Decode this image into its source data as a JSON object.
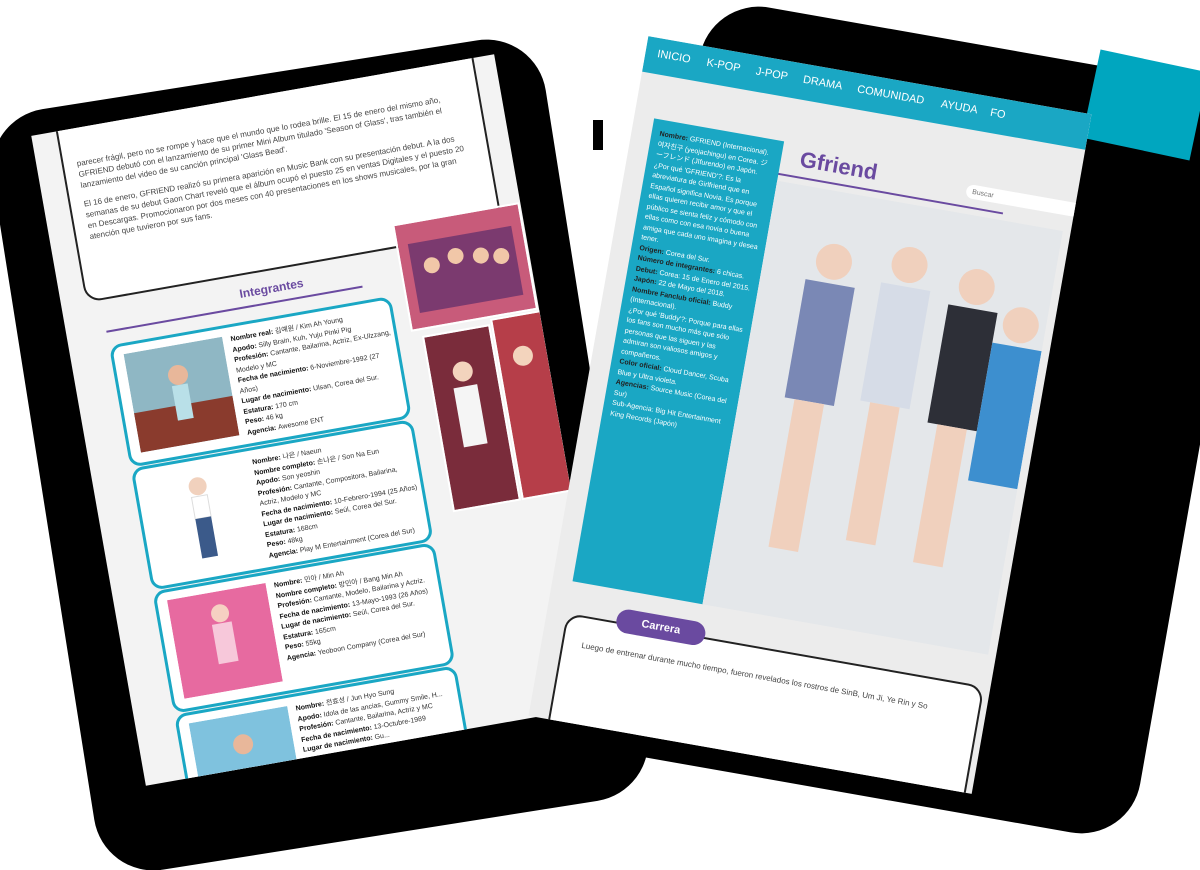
{
  "colors": {
    "teal": "#1aa7c4",
    "purple": "#6a4aa0",
    "page_bg": "#ececec"
  },
  "back_page": {
    "paragraph_1": "parecer frágil, pero no se rompe y hace que el mundo que lo rodea brille. El 15 de enero del mismo año, GFRIEND debutó con el lanzamiento de su primer Mini Album titulado 'Season of Glass', tras también el lanzamiento del video de su canción principal 'Glass Bead'.",
    "paragraph_2": "El 16 de enero, GFRIEND realizó su primera aparición en Music Bank con su presentación debut. A la dos semanas de su debut Gaon Chart reveló que el álbum ocupó el puesto 25 en ventas Digitales y el puesto 20 en Descargas. Promocionaron por dos meses con 40 presentaciones en los shows musicales, por la gran atención que tuvieron por sus fans.",
    "heading": "Integrantes",
    "members": [
      {
        "lines": [
          {
            "label": "Nombre real:",
            "value": "김예원 / Kim Ah Young"
          },
          {
            "label": "Apodo:",
            "value": "Silly Brain, Kuh, Yuju Pinki Pig"
          },
          {
            "label": "Profesión:",
            "value": "Cantante, Bailarina, Actriz, Ex-Ulzzang, Modelo y MC"
          },
          {
            "label": "Fecha de nacimiento:",
            "value": "6-Noviembre-1992 (27 Años)"
          },
          {
            "label": "Lugar de nacimiento:",
            "value": "Ulsan, Corea del Sur."
          },
          {
            "label": "Estatura:",
            "value": "170 cm"
          },
          {
            "label": "Peso:",
            "value": "46 kg"
          },
          {
            "label": "Agencia:",
            "value": "Awesome ENT"
          }
        ]
      },
      {
        "lines": [
          {
            "label": "Nombre:",
            "value": "나은 / Naeun"
          },
          {
            "label": "Nombre completo:",
            "value": "손나은 / Son Na Eun"
          },
          {
            "label": "Apodo:",
            "value": "Son yeoshin"
          },
          {
            "label": "Profesión:",
            "value": "Cantante, Compositora, Bailarina, Actriz, Modelo y MC"
          },
          {
            "label": "Fecha de nacimiento:",
            "value": "10-Febrero-1994 (25 Años)"
          },
          {
            "label": "Lugar de nacimiento:",
            "value": "Seúl, Corea del Sur."
          },
          {
            "label": "Estatura:",
            "value": "168cm"
          },
          {
            "label": "Peso:",
            "value": "48kg"
          },
          {
            "label": "Agencia:",
            "value": "Play M Entertainment (Corea del Sur)"
          }
        ]
      },
      {
        "lines": [
          {
            "label": "Nombre:",
            "value": "민아 / Min Ah"
          },
          {
            "label": "Nombre completo:",
            "value": "방민아 / Bang Min Ah"
          },
          {
            "label": "Profesión:",
            "value": "Cantante, Modelo, Bailarina y Actriz."
          },
          {
            "label": "Fecha de nacimiento:",
            "value": "13-Mayo-1993 (26 Años)"
          },
          {
            "label": "Lugar de nacimiento:",
            "value": "Seúl, Corea del Sur."
          },
          {
            "label": "Estatura:",
            "value": "165cm"
          },
          {
            "label": "Peso:",
            "value": "55kg"
          },
          {
            "label": "Agencia:",
            "value": "Yeoboon Company (Corea del Sur)"
          }
        ]
      },
      {
        "lines": [
          {
            "label": "Nombre:",
            "value": "전효성 / Jun Hyo Sung"
          },
          {
            "label": "Apodo:",
            "value": "Idola de las ancias, Gummy Smile, H..."
          },
          {
            "label": "Profesión:",
            "value": "Cantante, Bailarina, Actriz y MC"
          },
          {
            "label": "Fecha de nacimiento:",
            "value": "13-Octubre-1989"
          },
          {
            "label": "Lugar de nacimiento:",
            "value": "Gu..."
          }
        ]
      }
    ]
  },
  "front_page": {
    "nav": [
      "INICIO",
      "K-POP",
      "J-POP",
      "DRAMA",
      "COMUNIDAD",
      "AYUDA",
      "FO"
    ],
    "search_placeholder": "Buscar",
    "title": "Gfriend",
    "info_lines": [
      {
        "label": "Nombre:",
        "value": "GFRIEND (Internacional). 여자친구 (yeojachingu) en Corea. ジーフレンド (Jīfurendo) en Japón."
      },
      {
        "label": "",
        "value": "¿Por qué 'GFRIEND'?: Es la abreviatura de Girlfriend que en Español significa Novia. Es porque ellas quieren recibir amor y que el público se sienta feliz y cómodo con ellas como con esa novia o buena amiga que cada uno imagina y desea tener."
      },
      {
        "label": "Origen:",
        "value": "Corea del Sur."
      },
      {
        "label": "Número de integrantes:",
        "value": "6 chicas."
      },
      {
        "label": "Debut:",
        "value": "Corea: 15 de Enero del 2015."
      },
      {
        "label": "Japón:",
        "value": "22 de Mayo del 2018."
      },
      {
        "label": "Nombre Fanclub oficial:",
        "value": "Buddy (Internacional)."
      },
      {
        "label": "",
        "value": "¿Por qué 'Buddy'?: Porque para ellas los fans son mucho más que sólo personas que las siguen y las admiran son valiosos amigos y compañeros."
      },
      {
        "label": "Color oficial:",
        "value": "Cloud Dancer, Scuba Blue y Ultra violeta."
      },
      {
        "label": "Agencias:",
        "value": "Source Music (Corea del Sur)"
      },
      {
        "label": "",
        "value": "Sub-Agencia: Big Hit Entertainment"
      },
      {
        "label": "",
        "value": "King Records (Japón)"
      }
    ],
    "career_label": "Carrera",
    "career_text": "Luego de entrenar durante mucho tiempo, fueron revelados los rostros de SinB, Um Ji, Ye Rin y So"
  }
}
